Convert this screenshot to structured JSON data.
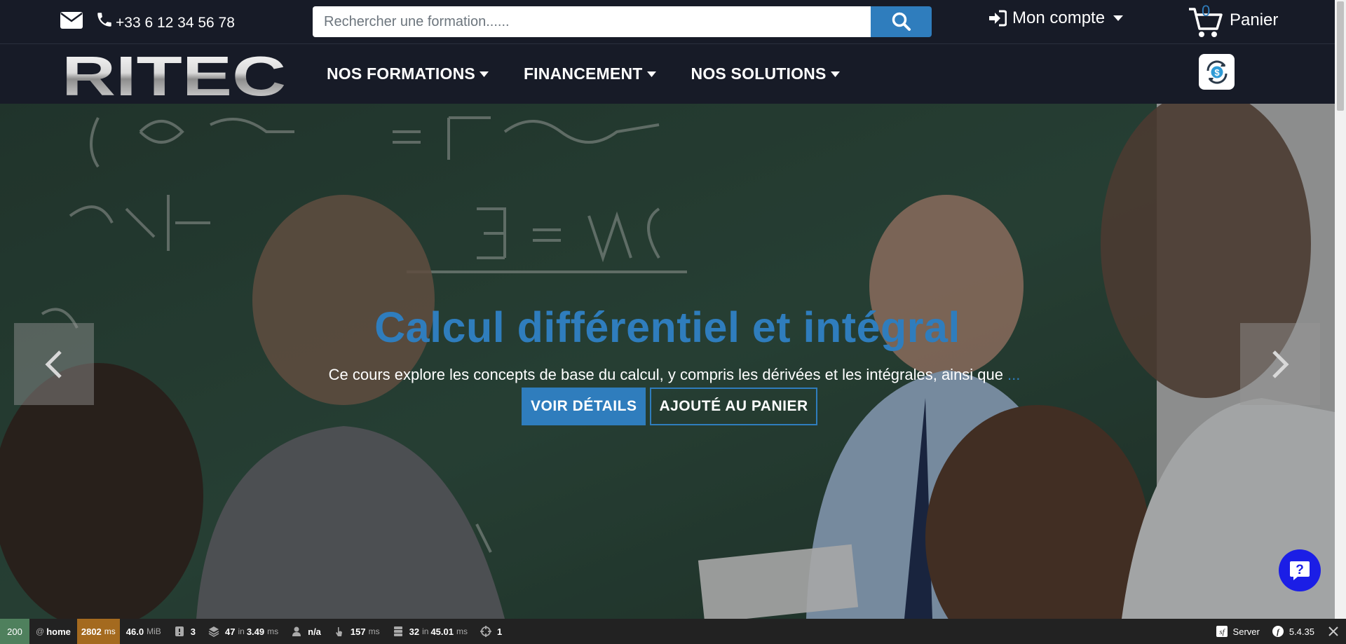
{
  "topbar": {
    "phone": "+33 6 12 34 56 78",
    "search_placeholder": "Rechercher une formation......",
    "account_label": "Mon compte",
    "cart_count": "0",
    "cart_label": "Panier"
  },
  "brand": {
    "logo_text": "RITEC"
  },
  "nav": {
    "items": [
      {
        "label": "NOS FORMATIONS"
      },
      {
        "label": "FINANCEMENT"
      },
      {
        "label": "NOS SOLUTIONS"
      }
    ]
  },
  "hero": {
    "title": "Calcul différentiel et intégral",
    "description": "Ce cours explore les concepts de base du calcul, y compris les dérivées et les intégrales, ainsi que",
    "ellipsis": "...",
    "details_button": "VOIR DÉTAILS",
    "cart_button": "AJOUTÉ AU PANIER"
  },
  "debug": {
    "status": "200",
    "route_prefix": "@",
    "route": "home",
    "time": "2802",
    "time_unit": "ms",
    "memory": "46.0",
    "memory_unit": "MiB",
    "logs": "3",
    "templates": "47",
    "templates_prefix": "in",
    "templates_time": "3.49",
    "templates_unit": "ms",
    "user": "n/a",
    "dispatch": "157",
    "dispatch_unit": "ms",
    "queries": "32",
    "queries_prefix": "in",
    "queries_time": "45.01",
    "queries_unit": "ms",
    "ajax": "1",
    "server_label": "Server",
    "version": "5.4.35"
  },
  "colors": {
    "accent": "#2f7dbd",
    "background": "#171b27",
    "help": "#1b1ee6"
  }
}
